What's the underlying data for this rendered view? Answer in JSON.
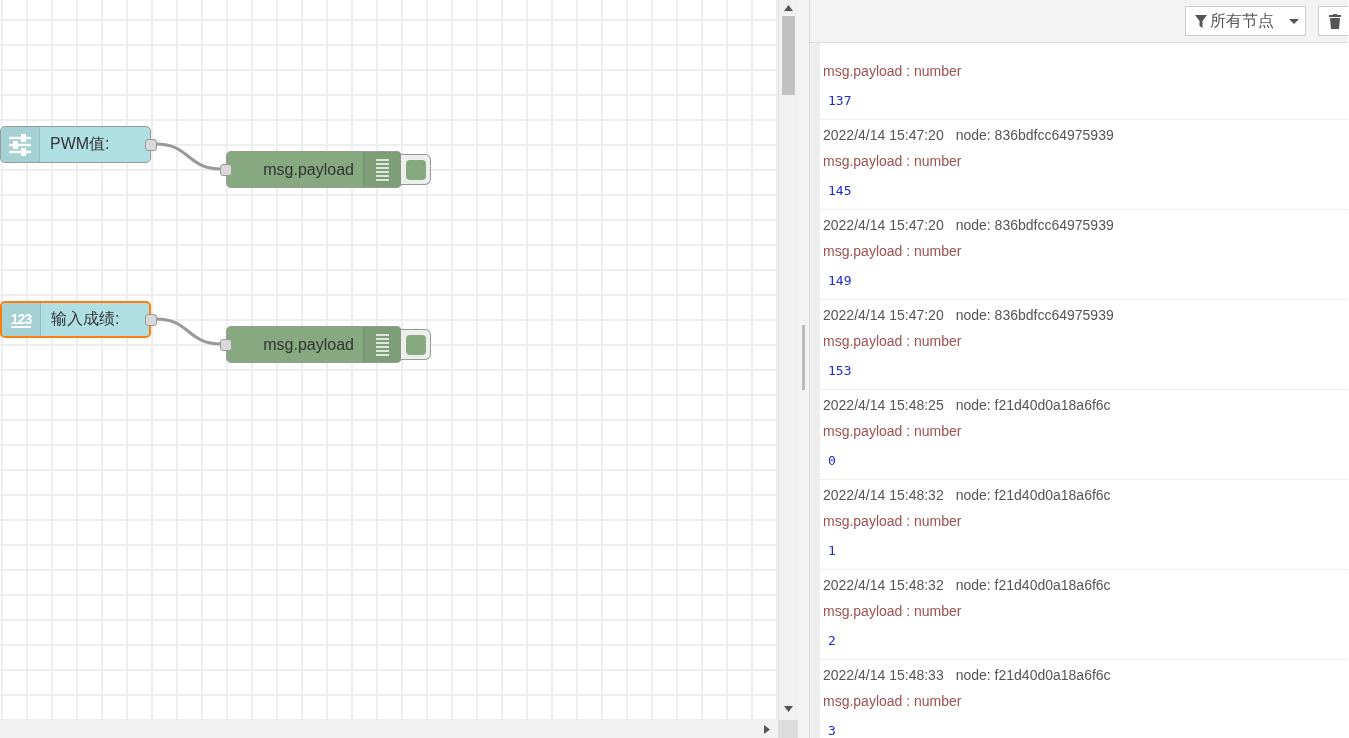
{
  "flows": [
    {
      "input": {
        "kind": "slider",
        "label": "PWM值:",
        "selected": false
      },
      "output": {
        "label": "msg.payload"
      }
    },
    {
      "input": {
        "kind": "numeric",
        "icon_text": "123",
        "label": "输入成绩:",
        "selected": true
      },
      "output": {
        "label": "msg.payload"
      }
    }
  ],
  "sidebar": {
    "filter_button": "所有节点",
    "messages": [
      {
        "topic": "msg.payload : number",
        "value": "137"
      },
      {
        "time": "2022/4/14 15:47:20",
        "node": "node: 836bdfcc64975939",
        "topic": "msg.payload : number",
        "value": "145"
      },
      {
        "time": "2022/4/14 15:47:20",
        "node": "node: 836bdfcc64975939",
        "topic": "msg.payload : number",
        "value": "149"
      },
      {
        "time": "2022/4/14 15:47:20",
        "node": "node: 836bdfcc64975939",
        "topic": "msg.payload : number",
        "value": "153"
      },
      {
        "time": "2022/4/14 15:48:25",
        "node": "node: f21d40d0a18a6f6c",
        "topic": "msg.payload : number",
        "value": "0"
      },
      {
        "time": "2022/4/14 15:48:32",
        "node": "node: f21d40d0a18a6f6c",
        "topic": "msg.payload : number",
        "value": "1"
      },
      {
        "time": "2022/4/14 15:48:32",
        "node": "node: f21d40d0a18a6f6c",
        "topic": "msg.payload : number",
        "value": "2"
      },
      {
        "time": "2022/4/14 15:48:33",
        "node": "node: f21d40d0a18a6f6c",
        "topic": "msg.payload : number",
        "value": "3"
      }
    ]
  }
}
